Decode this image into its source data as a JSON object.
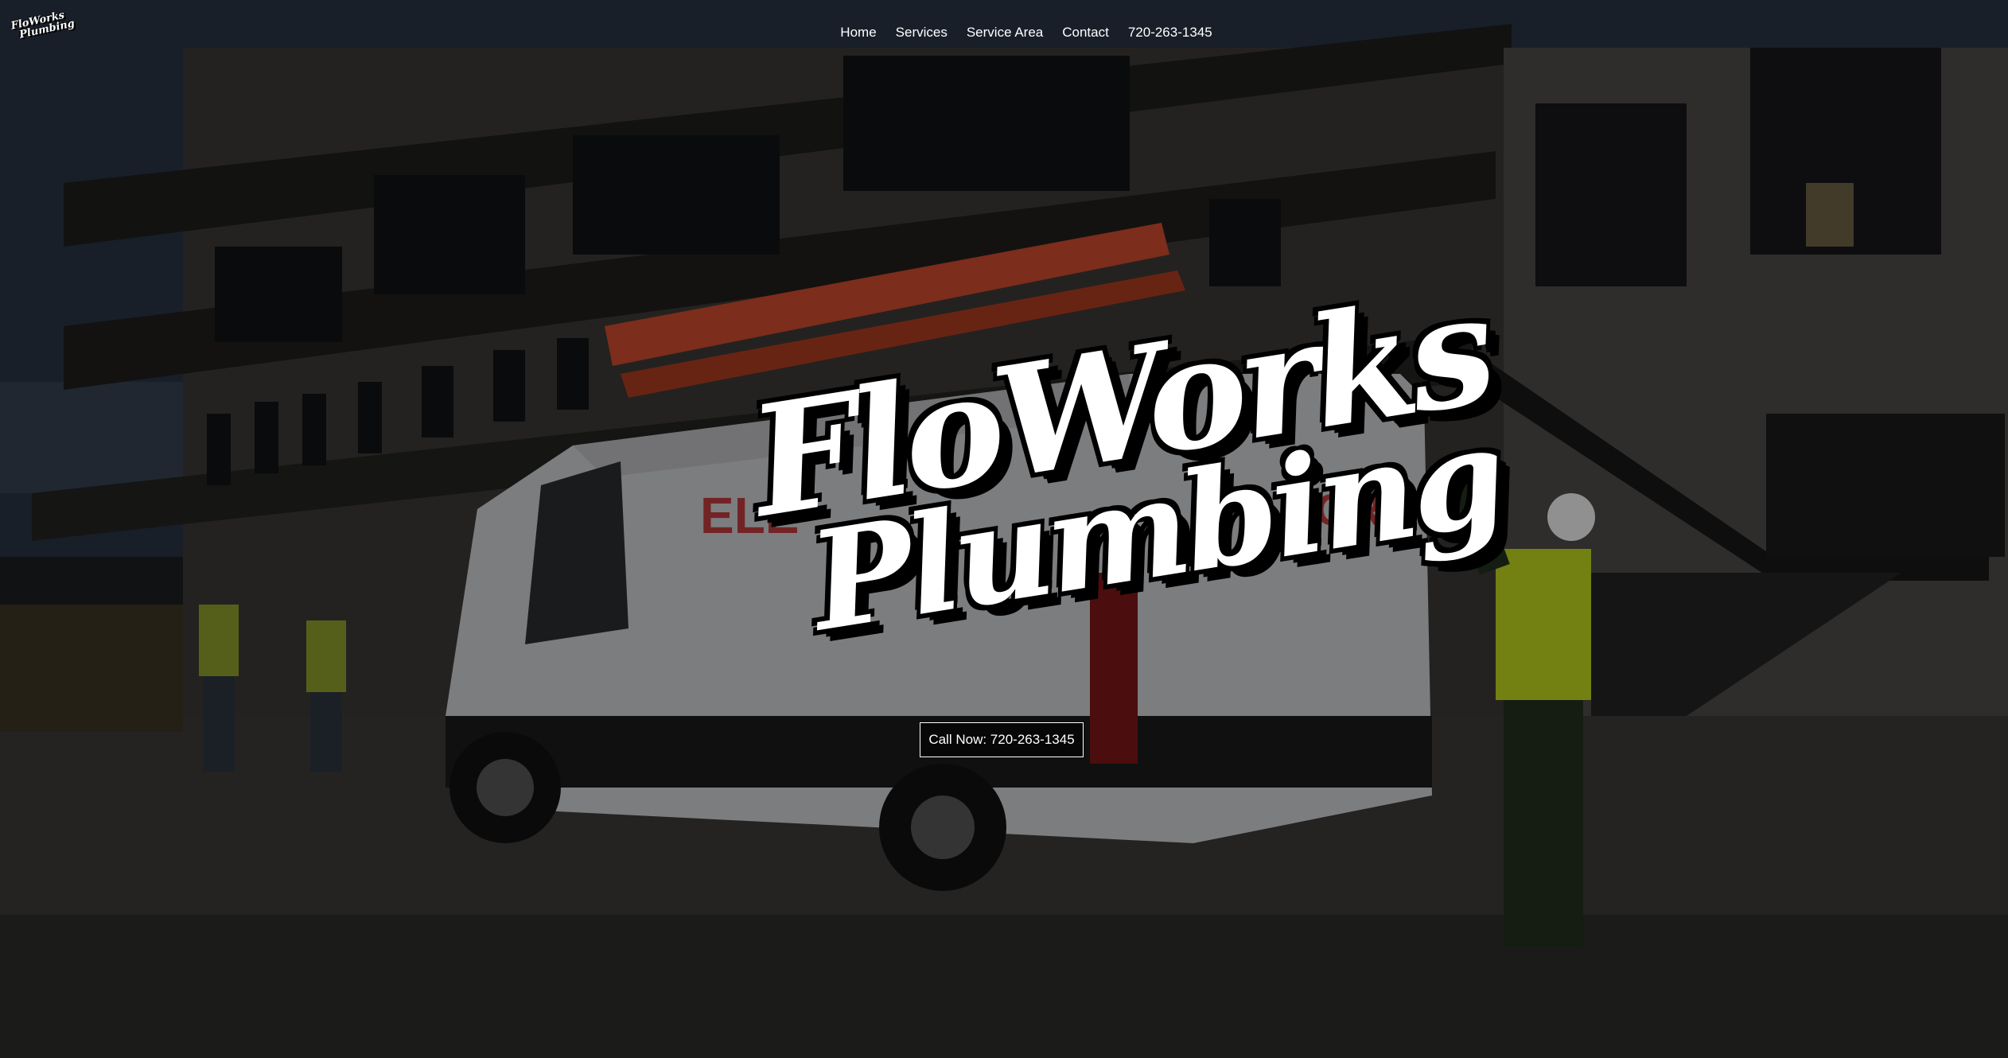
{
  "brand": {
    "small_line1": "FloWorks",
    "small_line2": "Plumbing",
    "hero_line1": "FloWorks",
    "hero_line2": "Plumbing"
  },
  "nav": {
    "items": [
      {
        "label": "Home"
      },
      {
        "label": "Services"
      },
      {
        "label": "Service Area"
      },
      {
        "label": "Contact"
      },
      {
        "label": "720-263-1345"
      }
    ]
  },
  "hero": {
    "cta_label": "Call Now: 720-263-1345",
    "van_text_left": "ELE",
    "van_text_right": "TOR"
  },
  "colors": {
    "overlay": "#000000",
    "text": "#ffffff",
    "van_text": "#b83a3a",
    "ladder": "#c84a2c",
    "vest": "#b9d11c"
  }
}
